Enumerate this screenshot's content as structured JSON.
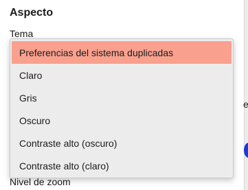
{
  "section": {
    "title": "Aspecto"
  },
  "fields": {
    "theme_label": "Tema",
    "zoom_label": "Nivel de zoom"
  },
  "background_fragment": {
    "right_text": "e"
  },
  "theme_dropdown": {
    "selected_index": 0,
    "options": [
      "Preferencias del sistema duplicadas",
      "Claro",
      "Gris",
      "Oscuro",
      "Contraste alto (oscuro)",
      "Contraste alto (claro)"
    ]
  },
  "colors": {
    "selected_highlight": "#f9a08e",
    "popup_background": "#ececec",
    "accent_blue": "#1a3bd6"
  }
}
